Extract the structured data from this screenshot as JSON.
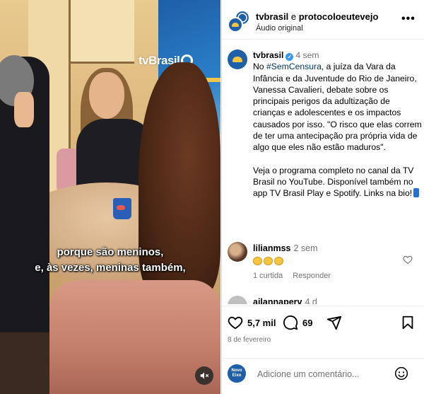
{
  "video": {
    "watermark": "tvBrasil",
    "subtitle_line1": "porque são meninos,",
    "subtitle_line2": "e, às vezes, meninas também,"
  },
  "header": {
    "account1": "tvbrasil",
    "separator": " e ",
    "account2": "protocoloeutevejo",
    "audio": "Áudio original"
  },
  "caption": {
    "username": "tvbrasil",
    "time": "4 sem",
    "text_before_tag": "No ",
    "hashtag": "#SemCensura",
    "text_after_tag": ", a juíza da Vara da Infância e da Juventude do Rio de Janeiro, Vanessa Cavalieri, debate sobre os principais perigos da adultização de crianças e adolescentes e os impactos causados por isso. \"O risco que elas correm de ter uma antecipação pra própria vida de algo que eles não estão maduros\".",
    "paragraph2": "Veja o programa completo no canal da TV Brasil no YouTube. Disponível também no app TV Brasil Play e Spotify. Links na bio!"
  },
  "comments": [
    {
      "username": "lilianmss",
      "time": "2 sem",
      "likes": "1 curtida",
      "reply": "Responder"
    },
    {
      "username": "ailannaperv",
      "time": "4 d"
    }
  ],
  "actions": {
    "likes_count": "5,7 mil",
    "comments_count": "69",
    "date": "8 de fevereiro"
  },
  "add_comment": {
    "avatar_text": "Novo Eixo",
    "placeholder": "Adicione um comentário..."
  },
  "icons": {
    "more": "more-options-icon",
    "verified": "verified-badge-icon",
    "heart": "heart-icon",
    "comment": "comment-icon",
    "share": "share-icon",
    "save": "bookmark-icon",
    "emoji": "emoji-icon",
    "mute": "mute-icon"
  },
  "colors": {
    "verified_blue": "#3897f0",
    "hashtag": "#00376b",
    "muted_text": "#737373",
    "brand_blue": "#1e5fa8",
    "brand_yellow": "#f5c542"
  }
}
